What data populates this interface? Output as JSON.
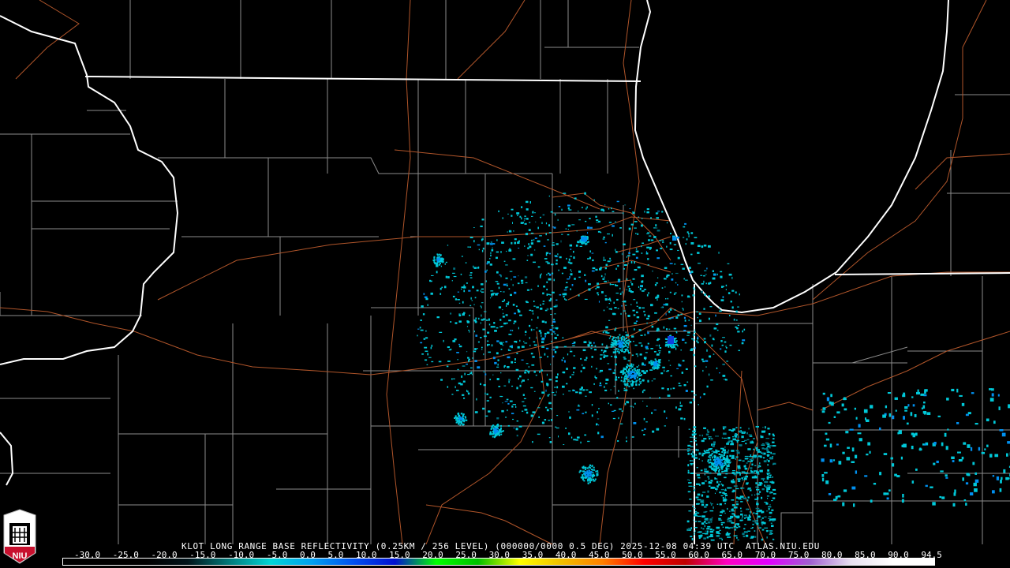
{
  "product": {
    "title": "KLOT LONG RANGE BASE REFLECTIVITY (0.25KM / 256 LEVEL) (000000/0000 0.5 DEG) 2025-12-08 04:39 UTC  ATLAS.NIU.EDU",
    "station": "KLOT",
    "timestamp": "2025-12-08 04:39 UTC",
    "source": "ATLAS.NIU.EDU"
  },
  "legend": {
    "unit_labels": [
      "-30.0",
      "-25.0",
      "-20.0",
      "-15.0",
      "-10.0",
      "-5.0",
      "0.0",
      "5.0",
      "10.0",
      "15.0",
      "20.0",
      "25.0",
      "30.0",
      "35.0",
      "40.0",
      "45.0",
      "50.0",
      "55.0",
      "60.0",
      "65.0",
      "70.0",
      "75.0",
      "80.0",
      "85.0",
      "90.0",
      "94.5"
    ],
    "color_stops": [
      "#000000",
      "#000000",
      "#000000",
      "#00141a",
      "#007a7a",
      "#00d4d4",
      "#00a0f0",
      "#0050f0",
      "#0010d0",
      "#00ff00",
      "#00c000",
      "#ffff00",
      "#f0c000",
      "#ff8000",
      "#ff0000",
      "#c00000",
      "#ff00c0",
      "#e000ff",
      "#a060d0",
      "#e8e0f0",
      "#ffffff",
      "#ffffff"
    ]
  },
  "logo": {
    "text": "NIU"
  },
  "colors": {
    "state": "#ffffff",
    "county": "#8c8c8c",
    "road": "#b0552a",
    "echo_light": "#00c8d8",
    "echo_mid": "#0090f0",
    "echo_strong": "#1040e0"
  }
}
